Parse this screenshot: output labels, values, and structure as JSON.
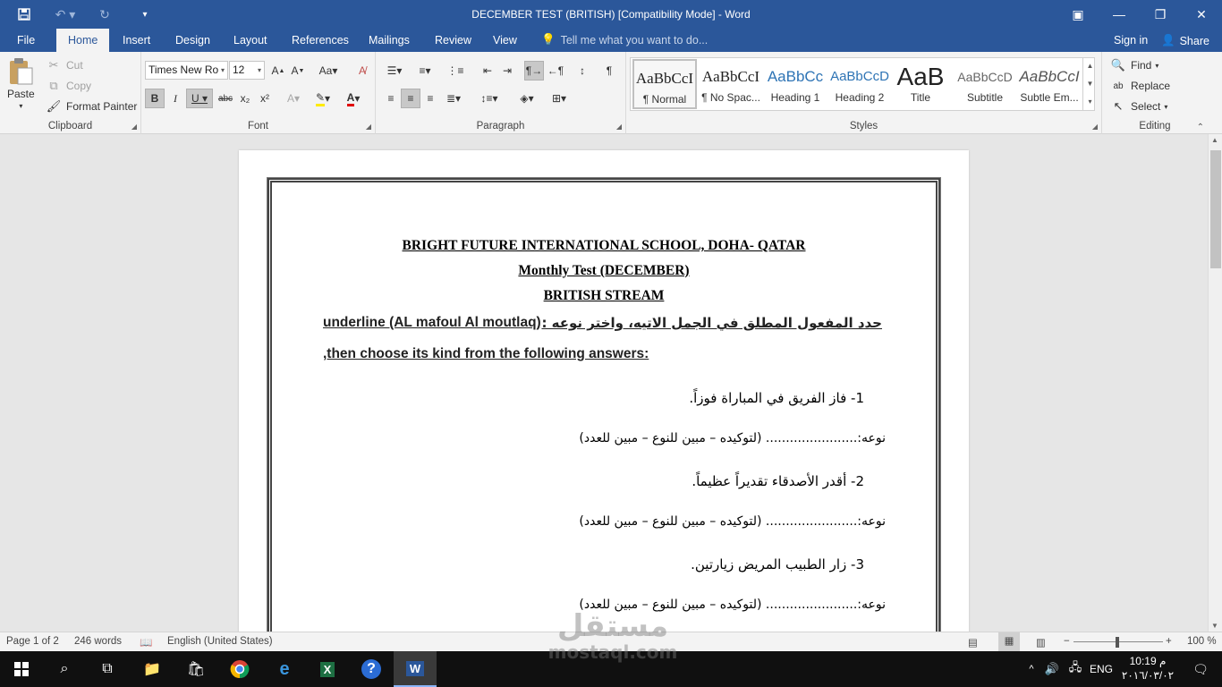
{
  "window": {
    "title": "DECEMBER TEST (BRITISH) [Compatibility Mode] - Word",
    "colors": {
      "accent": "#2b579a",
      "ribbon": "#f3f3f3",
      "doc_bg": "#e6e6e6"
    }
  },
  "qat": {
    "save_icon": "save-icon",
    "undo_icon": "undo-icon",
    "redo_icon": "redo-icon",
    "customize_icon": "customize-icon"
  },
  "tabs": [
    "File",
    "Home",
    "Insert",
    "Design",
    "Layout",
    "References",
    "Mailings",
    "Review",
    "View"
  ],
  "tell_me": "Tell me what you want to do...",
  "sign_in": "Sign in",
  "share": "Share",
  "clipboard": {
    "paste": "Paste",
    "cut": "Cut",
    "copy": "Copy",
    "format_painter": "Format Painter",
    "label": "Clipboard"
  },
  "font": {
    "name": "Times New Ro",
    "size": "12",
    "label": "Font"
  },
  "paragraph": {
    "label": "Paragraph"
  },
  "styles": {
    "label": "Styles",
    "items": [
      {
        "preview": "AaBbCcI",
        "name": "¶ Normal"
      },
      {
        "preview": "AaBbCcI",
        "name": "¶ No Spac..."
      },
      {
        "preview": "AaBbCc",
        "name": "Heading 1"
      },
      {
        "preview": "AaBbCcD",
        "name": "Heading 2"
      },
      {
        "preview": "AaB",
        "name": "Title"
      },
      {
        "preview": "AaBbCcD",
        "name": "Subtitle"
      },
      {
        "preview": "AaBbCcI",
        "name": "Subtle Em..."
      }
    ]
  },
  "editing": {
    "find": "Find",
    "replace": "Replace",
    "select": "Select",
    "label": "Editing"
  },
  "document": {
    "header1": "BRIGHT FUTURE INTERNATIONAL SCHOOL, DOHA- QATAR",
    "header2": "Monthly Test (DECEMBER)",
    "header3": "BRITISH STREAM",
    "instr_ar": "حدد المفعول المطلق في الجمل الاتيه، واختر نوعه :",
    "instr_en1": "underline (AL mafoul Al moutlaq)",
    "instr_en2": ",then choose its kind from the following answers:",
    "questions": [
      {
        "text": "1- فاز الفريق في المباراة فوزاً.",
        "answer": "نوعه:....................... (لتوكيده – مبين للنوع – مبين للعدد)"
      },
      {
        "text": "2- أقدر الأصدقاء تقديراً عظيماً.",
        "answer": "نوعه:....................... (لتوكيده – مبين للنوع – مبين للعدد)"
      },
      {
        "text": "3- زار الطبيب المريض زيارتين.",
        "answer": "نوعه:....................... (لتوكيده – مبين للنوع – مبين للعدد)"
      }
    ]
  },
  "status": {
    "page": "Page 1 of 2",
    "words": "246 words",
    "language": "English (United States)",
    "zoom": "100 %"
  },
  "taskbar": {
    "lang": "ENG",
    "time": "10:19 م",
    "date": "٢٠١٦/٠٣/٠٢"
  },
  "watermark": {
    "ar": "مستقل",
    "en": "mostaql.com"
  }
}
